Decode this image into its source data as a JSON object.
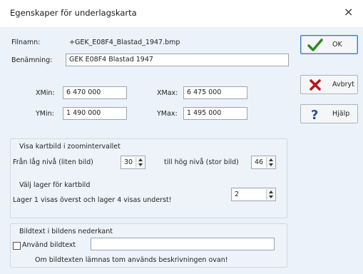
{
  "window": {
    "title": "Egenskaper för underlagskarta",
    "close_glyph": "×"
  },
  "file": {
    "filnamn_label": "Filnamn:",
    "filnamn_value": "+GEK_E08F4_Blastad_1947.bmp",
    "benamning_label": "Benämning:",
    "benamning_value": "GEK E08F4 Blastad 1947"
  },
  "coords": {
    "xmin_label": "XMin:",
    "xmin_value": "6 470 000",
    "xmax_label": "XMax:",
    "xmax_value": "6 475 000",
    "ymin_label": "YMin:",
    "ymin_value": "1 490 000",
    "ymax_label": "YMax:",
    "ymax_value": "1 495 000"
  },
  "zoom": {
    "heading": "Visa kartbild i zoomintervallet",
    "low_label": "Från låg nivå (liten bild)",
    "low_value": "30",
    "high_label": "till hög nivå (stor bild)",
    "high_value": "46"
  },
  "layer": {
    "heading": "Välj lager för kartbild",
    "desc": "Lager 1 visas överst och lager 4 visas underst!",
    "value": "2"
  },
  "caption": {
    "heading": "Bildtext i bildens nederkant",
    "checkbox_label": "Använd bildtext",
    "checked": false,
    "value": "",
    "note": "Om bildtexten lämnas tom används beskrivningen ovan!"
  },
  "buttons": {
    "ok": "OK",
    "cancel": "Avbryt",
    "help": "Hjälp"
  },
  "colors": {
    "ok_check": "#2e8b1e",
    "cancel_x": "#c0121b",
    "help_q": "#1e4fa8"
  },
  "icons": {
    "ok": "check-icon",
    "cancel": "x-mark-icon",
    "help": "question-icon"
  }
}
